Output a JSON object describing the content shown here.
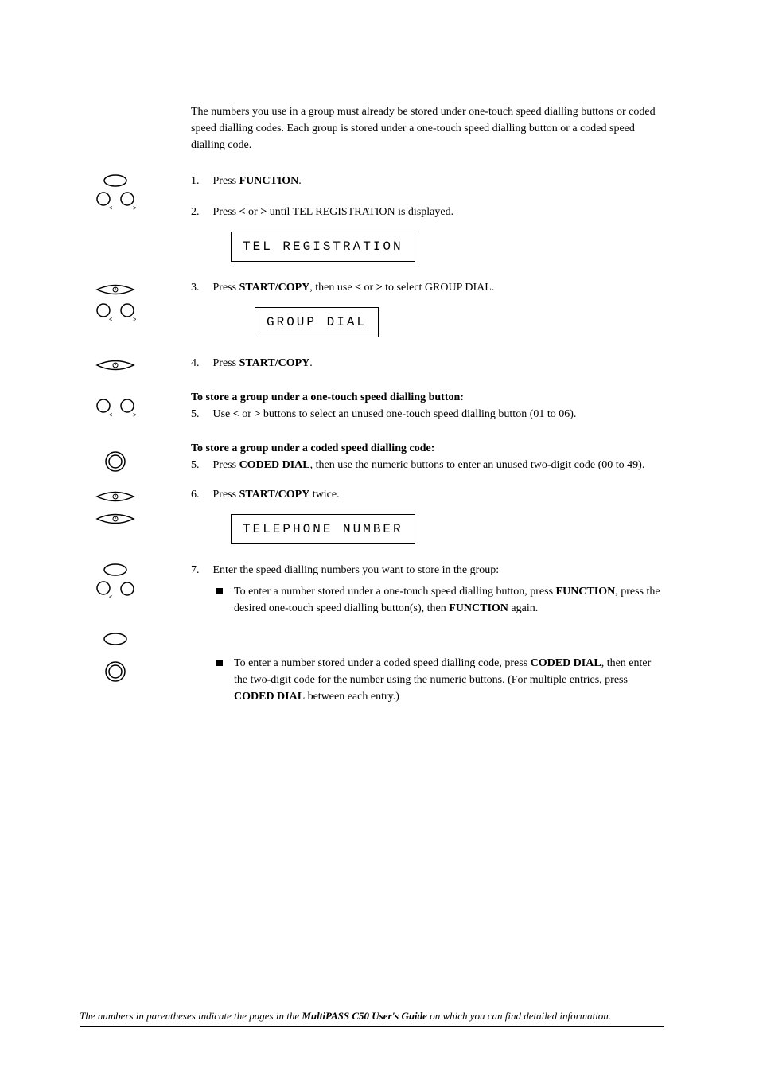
{
  "intro": "The numbers you use in a group must already be stored under one-touch speed dialling buttons or coded speed dialling codes. Each group is stored under a one-touch speed dialling button or a coded speed dialling code.",
  "steps": {
    "s1": {
      "num": "1.",
      "prefix": "Press ",
      "bold1": "FUNCTION",
      "suffix": "."
    },
    "s2": {
      "num": "2.",
      "prefix": "Press ",
      "bold1": "<",
      "mid1": " or ",
      "bold2": ">",
      "suffix": " until TEL REGISTRATION is displayed."
    },
    "display1": "TEL REGISTRATION",
    "s3": {
      "num": "3.",
      "prefix": "Press ",
      "bold1": "START/COPY",
      "mid1": ", then use ",
      "bold2": "<",
      "mid2": " or ",
      "bold3": ">",
      "suffix": " to select GROUP DIAL."
    },
    "display2": "GROUP DIAL",
    "s4": {
      "num": "4.",
      "prefix": "Press ",
      "bold1": "START/COPY",
      "suffix": "."
    },
    "heading_a": "To store a group under a one-touch speed dialling button:",
    "s5a": {
      "num": "5.",
      "prefix": "Use ",
      "bold1": "<",
      "mid1": " or ",
      "bold2": ">",
      "suffix": " buttons to select an unused one-touch speed dialling button (01 to 06)."
    },
    "heading_b": "To store a group under a coded speed dialling code:",
    "s5b": {
      "num": "5.",
      "prefix": "Press ",
      "bold1": "CODED DIAL",
      "suffix": ", then use the numeric buttons to enter an unused two-digit code (00 to 49)."
    },
    "s6": {
      "num": "6.",
      "prefix": "Press ",
      "bold1": "START/COPY",
      "suffix": " twice."
    },
    "display3": "TELEPHONE NUMBER",
    "s7": {
      "num": "7.",
      "text": "Enter the speed dialling numbers you want to store in the group:"
    },
    "bullet1": {
      "p1": "To enter a number stored under a one-touch speed dialling button, press ",
      "b1": "FUNCTION",
      "p2": ", press the desired one-touch speed dialling button(s), then ",
      "b2": "FUNCTION",
      "p3": " again."
    },
    "bullet2": {
      "p1": "To enter a number stored under a coded speed dialling code, press ",
      "b1": "CODED DIAL",
      "p2": ", then enter the two-digit code for the number using the numeric buttons. (For multiple entries, press ",
      "b2": "CODED DIAL",
      "p3": " between each entry.)"
    }
  },
  "footer": {
    "p1": "The numbers in parentheses indicate the pages in the ",
    "b1": "MultiPASS C50 User's Guide",
    "p2": " on which you can find detailed information."
  }
}
